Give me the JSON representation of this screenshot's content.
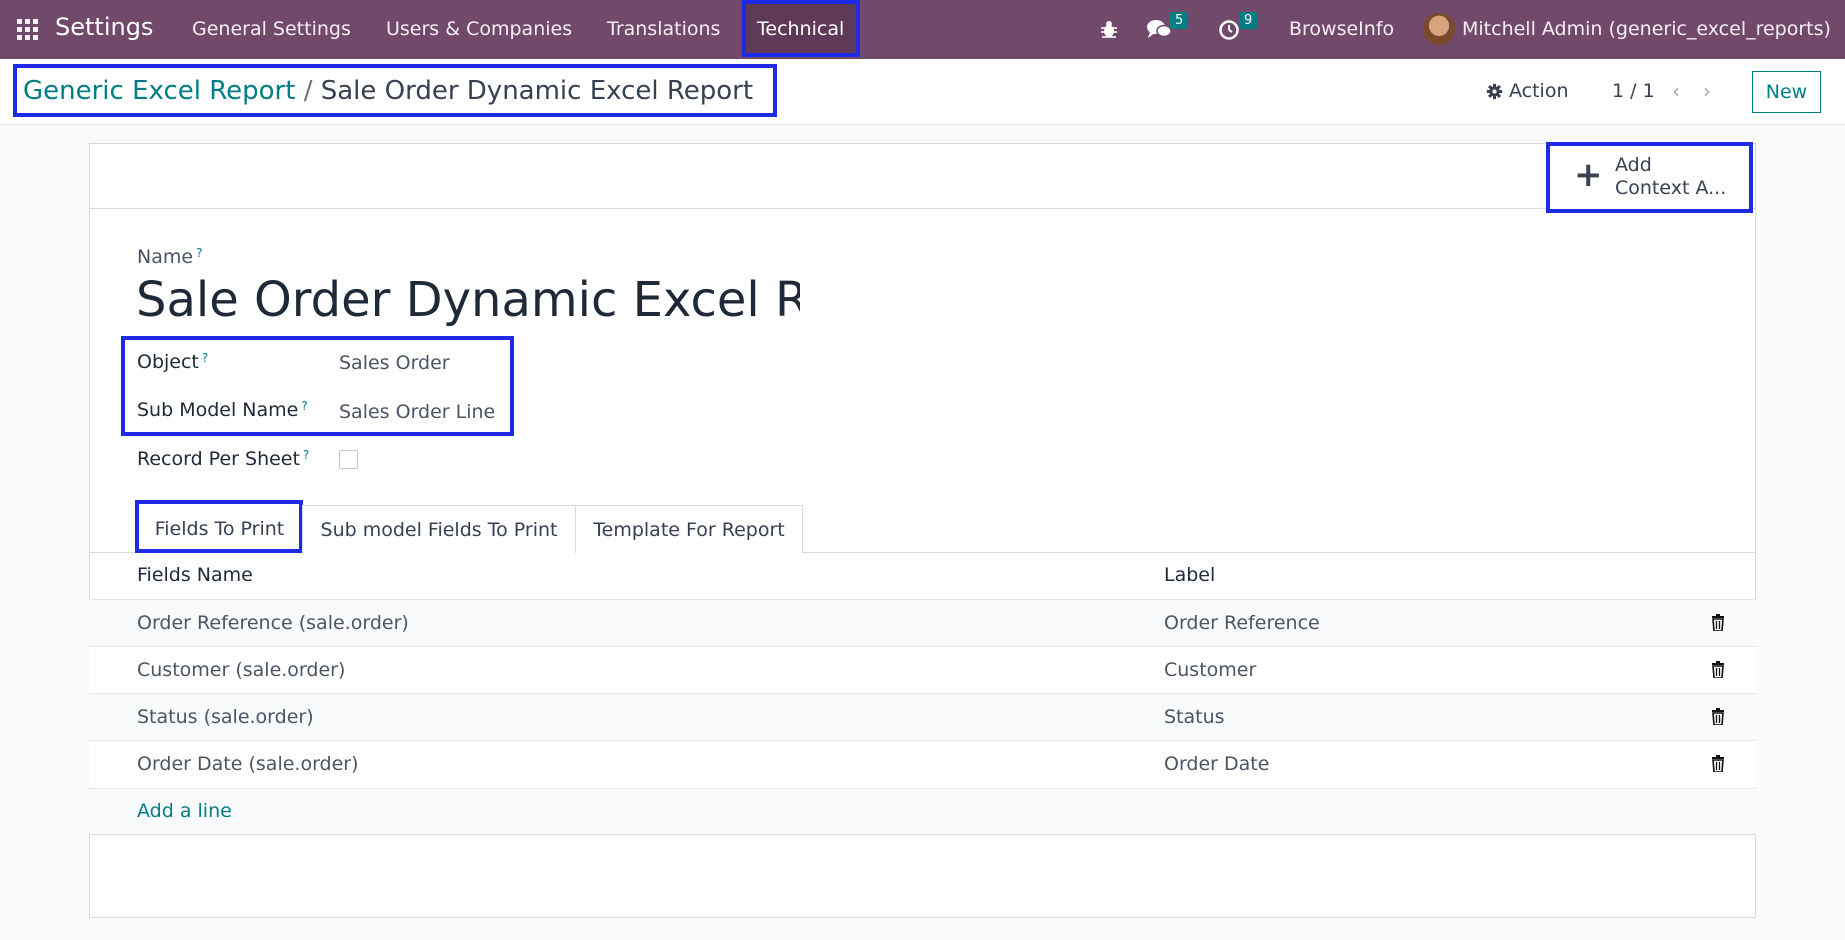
{
  "navbar": {
    "app_name": "Settings",
    "menu": {
      "general_settings": "General Settings",
      "users_companies": "Users & Companies",
      "translations": "Translations",
      "technical": "Technical"
    },
    "messages_count": "5",
    "activities_count": "9",
    "company": "BrowseInfo",
    "user": "Mitchell Admin (generic_excel_reports)",
    "icons": [
      "apps-grid-icon",
      "bug-icon",
      "chat-icon",
      "clock-icon"
    ]
  },
  "control_panel": {
    "breadcrumb_parent": "Generic Excel Report",
    "breadcrumb_separator": "/",
    "breadcrumb_current": "Sale Order Dynamic Excel Report",
    "action_label": "Action",
    "pager": "1 / 1",
    "new_label": "New"
  },
  "sheet": {
    "context_action_line1": "Add",
    "context_action_line2": "Context A...",
    "name_label": "Name",
    "name_value": "Sale Order Dynamic Excel Re",
    "help_mark": "?",
    "object_label": "Object",
    "object_value": "Sales Order",
    "sub_model_label": "Sub Model Name",
    "sub_model_value": "Sales Order Line",
    "record_per_sheet_label": "Record Per Sheet"
  },
  "tabs": {
    "fields_to_print": "Fields To Print",
    "sub_model_fields": "Sub model Fields To Print",
    "template": "Template For Report"
  },
  "table": {
    "col_fields_name": "Fields Name",
    "col_label": "Label",
    "rows": [
      {
        "field": "Order Reference (sale.order)",
        "label": "Order Reference"
      },
      {
        "field": "Customer (sale.order)",
        "label": "Customer"
      },
      {
        "field": "Status (sale.order)",
        "label": "Status"
      },
      {
        "field": "Order Date (sale.order)",
        "label": "Order Date"
      }
    ],
    "add_line": "Add a line"
  },
  "colors": {
    "navbar": "#71496a",
    "accent": "#017e84",
    "highlight": "#1f2ae8"
  }
}
